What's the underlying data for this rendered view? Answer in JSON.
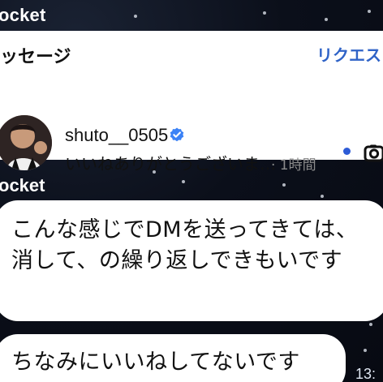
{
  "top": {
    "label": "ocket"
  },
  "shared_card": {
    "header": "ッセージ",
    "request_label": "リクエス",
    "user": {
      "name": "shuto__0505",
      "verified": true,
      "preview": "いいねありがとうございま…",
      "time": "· 1時間"
    },
    "icons": [
      "verified-badge-icon",
      "unread-dot-icon",
      "camera-icon"
    ]
  },
  "second": {
    "label": "ocket"
  },
  "messages": [
    {
      "text": "こんな感じでDMを送ってきては、消して、の繰り返しできもいです"
    },
    {
      "text": "ちなみにいいねしてないです"
    }
  ],
  "bottom": {
    "time": "13:"
  },
  "colors": {
    "background": "#0b0f1a",
    "bubble": "#ffffff",
    "accent_blue": "#2f63c7",
    "verified_blue": "#3b82f6",
    "muted": "#8b8b8b"
  }
}
